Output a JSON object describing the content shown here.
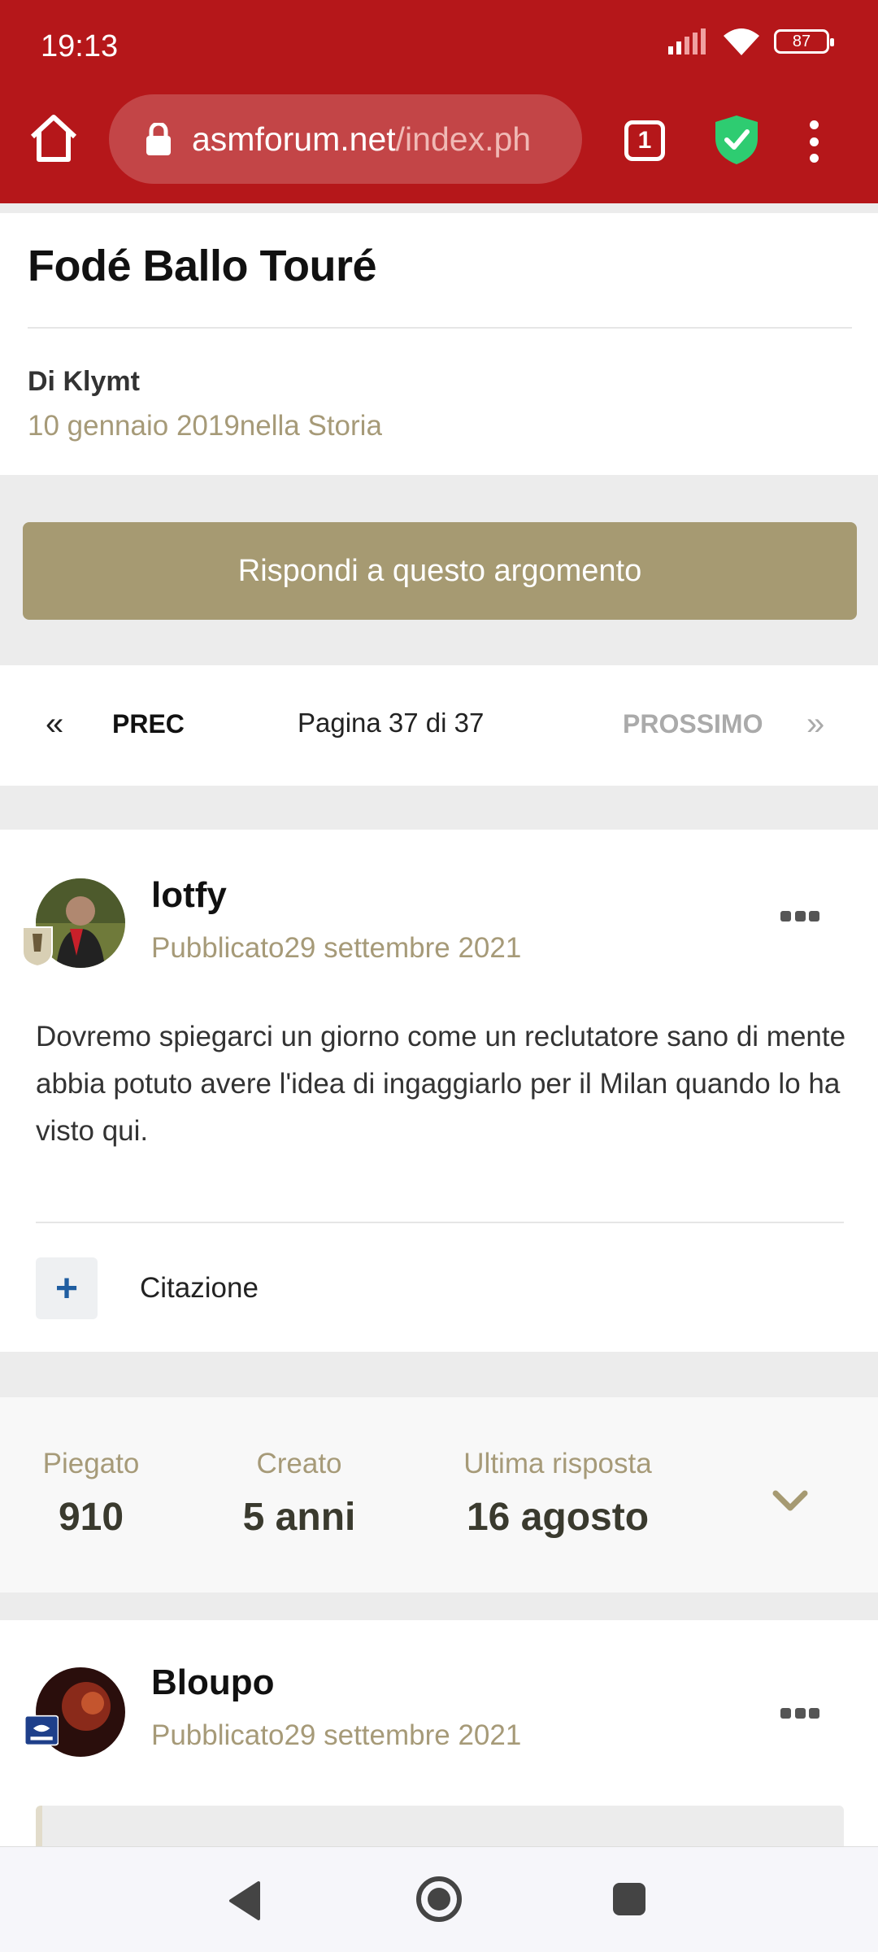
{
  "status_bar": {
    "time": "19:13",
    "battery": "87"
  },
  "browser": {
    "url_host": "asmforum.net",
    "url_path": "/index.ph",
    "tab_count": "1"
  },
  "topic": {
    "title": "Fodé Ballo Touré",
    "author": "Di Klymt",
    "date_category": "10 gennaio 2019nella Storia"
  },
  "reply_button": "Rispondi a questo argomento",
  "pagination": {
    "prev": "PREC",
    "page_info": "Pagina 37 di 37",
    "next": "PROSSIMO"
  },
  "posts": [
    {
      "author": "lotfy",
      "posted": "Pubblicato29 settembre 2021",
      "body": "Dovremo spiegarci un giorno come un reclutatore sano di mente abbia potuto avere l'idea di ingaggiarlo per il Milan quando lo ha visto qui.",
      "quote_label": "Citazione"
    },
    {
      "author": "Bloupo",
      "posted": "Pubblicato29 settembre 2021"
    }
  ],
  "stats": [
    {
      "label": "Piegato",
      "value": "910"
    },
    {
      "label": "Creato",
      "value": "5 anni"
    },
    {
      "label": "Ultima risposta",
      "value": "16 agosto"
    }
  ],
  "colors": {
    "topbar": "#b5171a",
    "accent": "#a69a72",
    "muted_gold": "#a69a78",
    "shield": "#2ecc71"
  }
}
